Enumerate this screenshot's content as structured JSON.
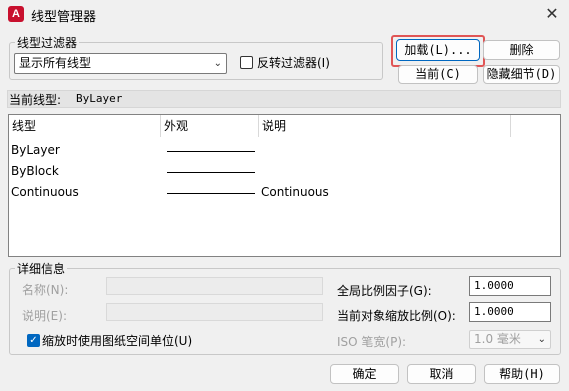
{
  "window": {
    "icon_letter": "A",
    "title": "线型管理器",
    "close_glyph": "✕"
  },
  "filter": {
    "group_label": "线型过滤器",
    "selected": "显示所有线型",
    "invert_label": "反转过滤器(I)",
    "invert_checked": false
  },
  "buttons": {
    "load": "加载(L)...",
    "delete": "删除",
    "current": "当前(C)",
    "hide_details": "隐藏细节(D)",
    "ok": "确定",
    "cancel": "取消",
    "help": "帮助(H)"
  },
  "current_linetype": {
    "label": "当前线型:",
    "value": "ByLayer"
  },
  "list": {
    "columns": [
      "线型",
      "外观",
      "说明"
    ],
    "rows": [
      {
        "name": "ByLayer",
        "description": ""
      },
      {
        "name": "ByBlock",
        "description": ""
      },
      {
        "name": "Continuous",
        "description": "Continuous"
      }
    ]
  },
  "details": {
    "group_label": "详细信息",
    "name_label": "名称(N):",
    "desc_label": "说明(E):",
    "paper_space_label": "缩放时使用图纸空间单位(U)",
    "paper_space_checked": true,
    "global_scale_label": "全局比例因子(G):",
    "global_scale_value": "1.0000",
    "object_scale_label": "当前对象缩放比例(O):",
    "object_scale_value": "1.0000",
    "iso_pen_label": "ISO 笔宽(P):",
    "iso_pen_value": "1.0 毫米"
  },
  "colors": {
    "highlight": "#e05555",
    "accent": "#0067c0",
    "app_icon": "#c8102e"
  }
}
